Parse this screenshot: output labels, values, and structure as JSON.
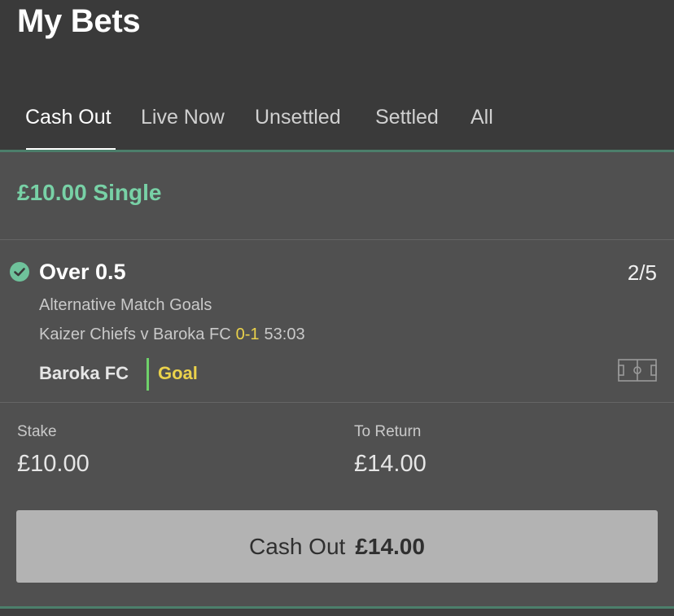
{
  "header": {
    "title": "My Bets",
    "tabs": [
      {
        "label": "Cash Out",
        "active": true
      },
      {
        "label": "Live Now",
        "active": false
      },
      {
        "label": "Unsettled",
        "active": false
      },
      {
        "label": "Settled",
        "active": false
      },
      {
        "label": "All",
        "active": false
      }
    ]
  },
  "bet": {
    "title": "£10.00 Single",
    "selection": {
      "status_icon": "check-circle-icon",
      "name": "Over 0.5",
      "odds": "2/5",
      "market": "Alternative Match Goals",
      "event": "Kaizer Chiefs v Baroka FC",
      "score": "0-1",
      "clock": "53:03",
      "incident_team": "Baroka FC",
      "incident_type": "Goal",
      "pitch_icon": "pitch-icon"
    },
    "stake_label": "Stake",
    "stake_value": "£10.00",
    "return_label": "To Return",
    "return_value": "£14.00",
    "cashout_label": "Cash Out",
    "cashout_amount": "£14.00"
  },
  "colors": {
    "header_bg": "#3a3a3a",
    "card_bg": "#505050",
    "accent_green": "#78d1a6",
    "score_yellow": "#ebd24b",
    "incident_bar": "#6fd16a",
    "button_bg": "#b3b3b3"
  }
}
